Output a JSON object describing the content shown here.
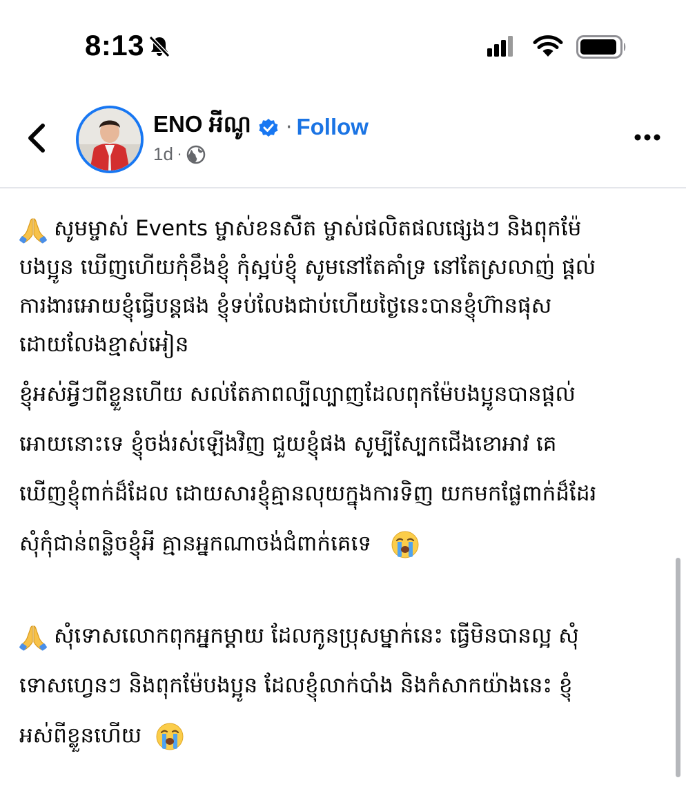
{
  "status_bar": {
    "time": "8:13",
    "icons": [
      "bell-slash-icon",
      "cellular-signal-icon",
      "wifi-icon",
      "battery-icon"
    ]
  },
  "post_header": {
    "author_name": "ENO អីណូ",
    "follow_label": "Follow",
    "separator": "·",
    "time_ago": "1d",
    "audience": "globe-icon",
    "colors": {
      "follow": "#1b74e4",
      "verified": "#1877f2",
      "avatar_ring": "#1877f2"
    }
  },
  "post": {
    "paragraph1": [
      "សូមម្ចាស់ Events ម្ចាស់ខនសឺត ម្ចាស់ផលិតផលផ្សេងៗ និងពុកម៉ែ",
      "បងប្អូន ឃើញហើយកុំខឹងខ្ញុំ កុំស្អប់ខ្ញុំ សូមនៅតែគាំទ្រ នៅតែស្រលាញ់ ផ្តល់",
      "ការងារអោយខ្ញុំធ្វើបន្តផង ខ្ញុំទប់លែងជាប់ហើយថ្ងៃនេះបានខ្ញុំហ៊ានផុស",
      "ដោយលែងខ្មាស់អៀន",
      "ខ្ញុំអស់អ្វីៗពីខ្លួនហើយ សល់តែភាពល្បីល្បាញដែលពុកម៉ែបងប្អូនបានផ្តល់",
      "អោយនោះទេ ខ្ញុំចង់រស់ឡើងវិញ  ជួយខ្ញុំផង សូម្បីស្បែកជើងខោអាវ គេ",
      "ឃើញខ្ញុំពាក់ដ៏ដែល ដោយសារខ្ញុំគ្មានលុយក្នុងការទិញ យកមកផ្លែពាក់ដ៏ដែរ",
      "សុំកុំជាន់ពន្លិចខ្ញុំអី គ្មានអ្នកណាចង់ជំពាក់គេទេ"
    ],
    "paragraph2": [
      "សុំទោសលោកពុកអ្នកម្តាយ ដែលកូនប្រុសម្នាក់នេះ ធ្វើមិនបានល្អ សុំ",
      "ទោសហ្វេនៗ និងពុកម៉ែបងប្អូន ដែលខ្ញុំលាក់បាំង និងកំសាកយ៉ាងនេះ  ខ្ញុំ",
      "អស់ពីខ្លួនហើយ"
    ],
    "emojis": [
      "folded-hands-icon",
      "crying-face-icon"
    ]
  }
}
